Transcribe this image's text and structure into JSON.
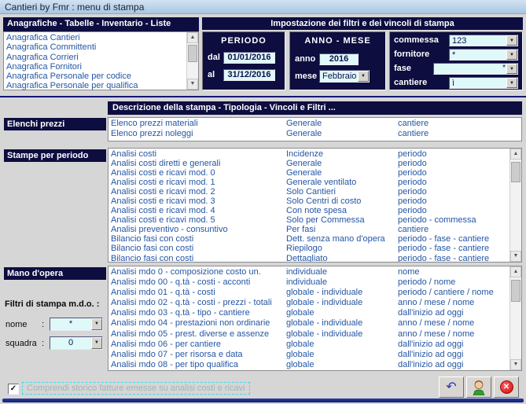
{
  "window_title": "Cantieri by Fmr : menu di stampa",
  "anagrafiche": {
    "header": "Anagrafiche - Tabelle - Inventario - Liste",
    "items": [
      "Anagrafica Cantieri",
      "Anagrafica Committenti",
      "Anagrafica Corrieri",
      "Anagrafica Fornitori",
      "Anagrafica Personale per codice",
      "Anagrafica Personale per qualifica"
    ]
  },
  "filters": {
    "header": "Impostazione dei filtri e dei vincoli di stampa",
    "periodo": {
      "title": "PERIODO",
      "dal_label": "dal",
      "dal_value": "01/01/2016",
      "al_label": "al",
      "al_value": "31/12/2016"
    },
    "anno_mese": {
      "title": "ANNO - MESE",
      "anno_label": "anno",
      "anno_value": "2016",
      "mese_label": "mese",
      "mese_value": "Febbraio"
    },
    "vincoli": [
      {
        "label": "commessa",
        "value": "123",
        "suffix": ""
      },
      {
        "label": "fornitore",
        "value": "*",
        "suffix": ""
      },
      {
        "label": "fase",
        "value": "",
        "suffix": "*"
      },
      {
        "label": "cantiere",
        "value": "ì",
        "suffix": ""
      }
    ]
  },
  "lists": {
    "header": "Descrizione della stampa - Tipologia - Vincoli e Filtri ...",
    "elenchi_label": "Elenchi prezzi",
    "elenchi_rows": [
      [
        "Elenco prezzi materiali",
        "Generale",
        "cantiere"
      ],
      [
        "Elenco prezzi noleggi",
        "Generale",
        "cantiere"
      ]
    ],
    "stampe_label": "Stampe per periodo",
    "stampe_rows": [
      [
        "Analisi costi",
        "Incidenze",
        "periodo"
      ],
      [
        "Analisi costi diretti e generali",
        "Generale",
        "periodo"
      ],
      [
        "Analisi costi e ricavi mod. 0",
        "Generale",
        "periodo"
      ],
      [
        "Analisi costi e ricavi mod. 1",
        "Generale ventilato",
        "periodo"
      ],
      [
        "Analisi costi e ricavi mod. 2",
        "Solo Cantieri",
        "periodo"
      ],
      [
        "Analisi costi e ricavi mod. 3",
        "Solo Centri di costo",
        "periodo"
      ],
      [
        "Analisi costi e ricavi mod. 4",
        "Con note spesa",
        "periodo"
      ],
      [
        "Analisi costi e ricavi mod. 5",
        "Solo per Commessa",
        "periodo - commessa"
      ],
      [
        "Analisi preventivo - consuntivo",
        "Per fasi",
        "cantiere"
      ],
      [
        "Bilancio fasi con costi",
        "Dett. senza mano d'opera",
        "periodo - fase - cantiere"
      ],
      [
        "Bilancio fasi con costi",
        "Riepilogo",
        "periodo - fase - cantiere"
      ],
      [
        "Bilancio fasi con costi",
        "Dettagliato",
        "periodo - fase - cantiere"
      ]
    ],
    "mdo_label": "Mano d'opera",
    "mdo_rows": [
      [
        "Analisi mdo 0  - composizione costo un.",
        "individuale",
        "nome"
      ],
      [
        "Analisi mdo 00 - q.tà - costi - acconti",
        "individuale",
        "periodo / nome"
      ],
      [
        "Analisi mdo 01 - q.tà - costi",
        "globale - individuale",
        "periodo / cantiere / nome"
      ],
      [
        "Analisi mdo 02 - q.tà - costi - prezzi - totali",
        "globale - individuale",
        "anno / mese / nome"
      ],
      [
        "Analisi mdo 03 - q.tà - tipo - cantiere",
        "globale",
        "dall'inizio ad oggi"
      ],
      [
        "Analisi mdo 04 - prestazioni non ordinarie",
        "globale - individuale",
        "anno / mese / nome"
      ],
      [
        "Analisi mdo 05 - prest. diverse e assenze",
        "globale - individuale",
        "anno / mese / nome"
      ],
      [
        "Analisi mdo 06 - per cantiere",
        "globale",
        "dall'inizio ad oggi"
      ],
      [
        "Analisi mdo 07 - per risorsa e data",
        "globale",
        "dall'inizio ad oggi"
      ],
      [
        "Analisi mdo 08 - per tipo qualifica",
        "globale",
        "dall'inizio ad oggi"
      ]
    ]
  },
  "mdo_filters": {
    "title": "Filtri di stampa m.d.o. :",
    "nome_label": "nome",
    "nome_colon": ":",
    "nome_value": "*",
    "squadra_label": "squadra",
    "squadra_colon": ":",
    "squadra_value": "0"
  },
  "footer": {
    "checkbox_label": "Comprendi storico fatture emesse su analisi costi e ricavi",
    "checkbox_checked": "✓"
  },
  "icons": {
    "scroll_up": "▲",
    "scroll_down": "▼",
    "combo_arrow": "▼",
    "undo": "↶",
    "close": "✕"
  },
  "colors": {
    "navy_header": "#0d0d40",
    "field_cyan": "#dff9f9",
    "list_text_blue": "#2456a4",
    "separator_blue": "#16167a",
    "focus_dash_cyan": "#45d9e8",
    "close_red": "#d80f0f"
  }
}
